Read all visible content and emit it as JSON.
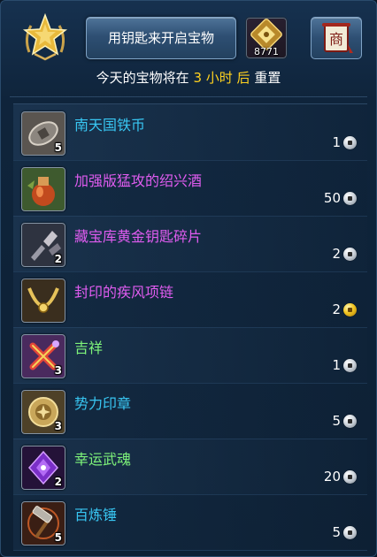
{
  "header": {
    "open_button_label": "用钥匙来开启宝物",
    "key_count": "8771",
    "reset_prefix": "今天的宝物将在",
    "reset_hours": "3 小时 后",
    "reset_suffix": "重置"
  },
  "colors": {
    "blue_name": "#38c6f2",
    "purple_name": "#e05cf0",
    "green_name": "#7ef37a",
    "highlight_yellow": "#ffd21f"
  },
  "items": [
    {
      "name": "南天国铁币",
      "icon_count": "5",
      "price": "1",
      "currency": "silver",
      "name_color": "#38c6f2",
      "icon": "iron-coin-icon"
    },
    {
      "name": "加强版猛攻的绍兴酒",
      "icon_count": "",
      "price": "50",
      "currency": "silver",
      "name_color": "#e05cf0",
      "icon": "wine-jar-icon"
    },
    {
      "name": "藏宝库黄金钥匙碎片",
      "icon_count": "2",
      "price": "2",
      "currency": "silver",
      "name_color": "#e05cf0",
      "icon": "key-fragment-icon"
    },
    {
      "name": "封印的疾风项链",
      "icon_count": "",
      "price": "2",
      "currency": "gold",
      "name_color": "#e05cf0",
      "icon": "necklace-icon"
    },
    {
      "name": "吉祥",
      "icon_count": "3",
      "price": "1",
      "currency": "silver",
      "name_color": "#7ef37a",
      "icon": "lucky-charm-icon"
    },
    {
      "name": "势力印章",
      "icon_count": "3",
      "price": "5",
      "currency": "silver",
      "name_color": "#38c6f2",
      "icon": "faction-seal-icon"
    },
    {
      "name": "幸运武魂",
      "icon_count": "2",
      "price": "20",
      "currency": "silver",
      "name_color": "#7ef37a",
      "icon": "lucky-soul-gem-icon"
    },
    {
      "name": "百炼锤",
      "icon_count": "5",
      "price": "5",
      "currency": "silver",
      "name_color": "#38c6f2",
      "icon": "hammer-icon"
    }
  ]
}
